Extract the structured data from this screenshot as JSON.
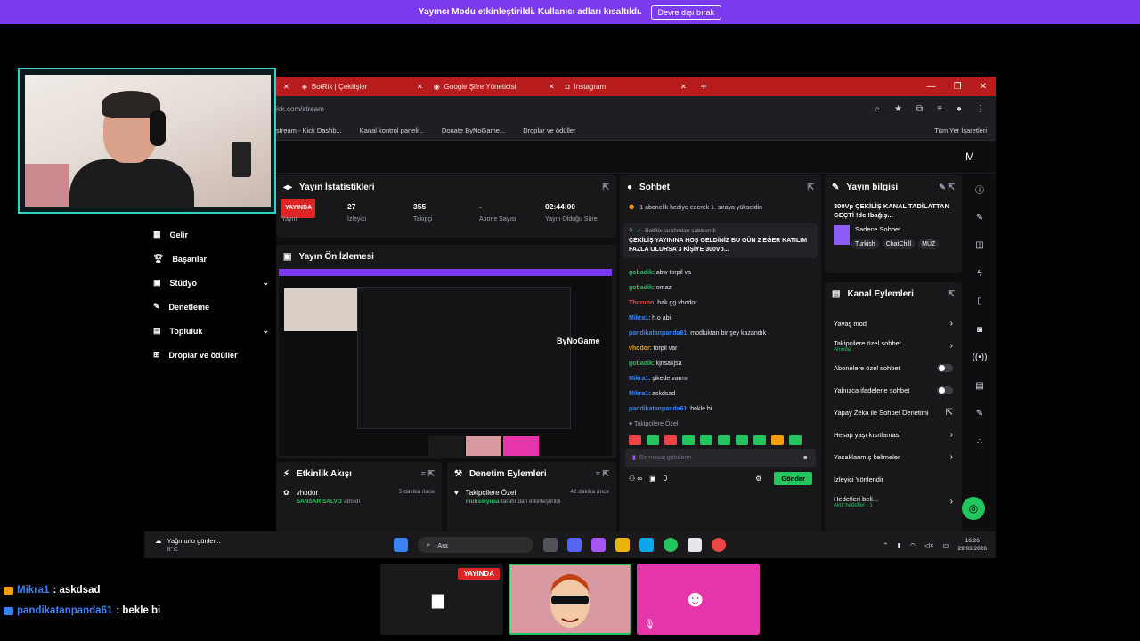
{
  "banner": {
    "text": "Yayıncı Modu etkinleştirildi. Kullanıcı adları kısaltıldı.",
    "button": "Devre dışı bırak"
  },
  "browser": {
    "tabs": [
      {
        "label": "BotRix | Çekilişler"
      },
      {
        "label": "Google Şifre Yöneticisi"
      },
      {
        "label": "Instagram"
      }
    ],
    "address": "ick.com/stream",
    "bookmarks": [
      "stream - Kick Dashb...",
      "Kanal kontrol paneli...",
      "Donate ByNoGame...",
      "Droplar ve ödüller"
    ],
    "all_bookmarks": "Tüm Yer İşaretleri"
  },
  "left_nav": {
    "items": [
      {
        "label": "Gelir",
        "icon": "chart-icon"
      },
      {
        "label": "Başarılar",
        "icon": "trophy-icon"
      },
      {
        "label": "Stüdyo",
        "icon": "studio-icon"
      },
      {
        "label": "Denetleme",
        "icon": "wrench-icon"
      },
      {
        "label": "Topluluk",
        "icon": "community-icon"
      },
      {
        "label": "Droplar ve ödüller",
        "icon": "gift-icon"
      }
    ]
  },
  "stats": {
    "title": "Yayın İstatistikleri",
    "live_badge": "YAYINDA",
    "cells": [
      {
        "value": "",
        "label": "Yayın"
      },
      {
        "value": "27",
        "label": "İzleyici"
      },
      {
        "value": "355",
        "label": "Takipçi"
      },
      {
        "value": "-",
        "label": "Abone Sayısı"
      },
      {
        "value": "02:44:00",
        "label": "Yayın Olduğu Süre"
      }
    ]
  },
  "preview": {
    "title": "Yayın Ön İzlemesi",
    "brand": "ByNoGame"
  },
  "activity": {
    "title": "Etkinlik Akışı",
    "items": [
      {
        "user": "vhodor",
        "sub": "SANSAR SALVO",
        "subtail": "atmıdı",
        "time": "5 dakika önce"
      }
    ]
  },
  "moderation": {
    "title": "Denetim Eylemleri",
    "items": [
      {
        "title": "Takipçilere Özel",
        "sub": "muhsinyusa",
        "subtail": "tarafından etkinleştirildi",
        "time": "42 dakika önce"
      }
    ]
  },
  "chat": {
    "title": "Sohbet",
    "gift_notice": "1 abonelik hediye ederek 1. sıraya yükseldin",
    "pinned_by": "BotRix tarafından sabitlendi",
    "pinned_text": "ÇEKİLİŞ YAYININA HOŞ GELDİNİZ BU GÜN 2 EĞER KATILIM FAZLA OLURSA 3 KİŞİYE 300Vp...",
    "messages": [
      {
        "user": "gobadik",
        "text": "abw torpil va",
        "color": "#22c55e"
      },
      {
        "user": "gobadik",
        "text": "omaz",
        "color": "#22c55e"
      },
      {
        "user": "Thorunn",
        "text": "hak gg vhodor",
        "color": "#ef4444"
      },
      {
        "user": "Mikra1",
        "text": "h.o abi",
        "color": "#3b82f6"
      },
      {
        "user": "pandikatanpanda61",
        "text": "modluktan bir şey kazandık",
        "color": "#3b82f6"
      },
      {
        "user": "vhodor",
        "text": "torpil var",
        "color": "#f59e0b"
      },
      {
        "user": "gobadik",
        "text": "kjnsakjsa",
        "color": "#22c55e"
      },
      {
        "user": "Mikra1",
        "text": "şikede varmı",
        "color": "#3b82f6"
      },
      {
        "user": "Mikra1",
        "text": "askdsad",
        "color": "#3b82f6"
      },
      {
        "user": "pandikatanpanda61",
        "text": "bekle bi",
        "color": "#3b82f6"
      }
    ],
    "followers_only": "Takipçilere Özel",
    "placeholder": "Bir mesaj gönderin",
    "counter": "0",
    "send": "Gönder"
  },
  "info": {
    "title": "Yayın bilgisi",
    "stream_title": "300Vp ÇEKİLİŞ KANAL TADİLATTAN GEÇTİ !dc !bağış...",
    "category": "Sadece Sohbet",
    "tags": [
      "Turkish",
      "ChatChill",
      "MÜZ"
    ]
  },
  "channel": {
    "title": "Kanal Eylemleri",
    "actions": [
      {
        "label": "Yavaş mod",
        "kind": "arrow"
      },
      {
        "label": "Takipçilere özel sohbet",
        "sub": "Anında",
        "kind": "arrow"
      },
      {
        "label": "Abonelere özel sohbet",
        "kind": "toggle"
      },
      {
        "label": "Yalnızca ifadelerle sohbet",
        "kind": "toggle"
      },
      {
        "label": "Yapay Zeka ile Sohbet Denetimi",
        "kind": "ext"
      },
      {
        "label": "Hesap yaşı kısıtlaması",
        "kind": "arrow"
      },
      {
        "label": "Yasaklanmış kelimeler",
        "kind": "arrow"
      },
      {
        "label": "İzleyici Yönlendir",
        "kind": "none"
      },
      {
        "label": "Hedefleri beli...",
        "sub": "Aktif hedefler - 1",
        "kind": "arrow"
      }
    ]
  },
  "taskbar": {
    "weather": "Yağmurlu günler...",
    "temp": "8°C",
    "search": "Ara",
    "time": "16:26",
    "date": "29.03.2026"
  },
  "overlay_chat": [
    {
      "user": "Mikra1",
      "text": ": askdsad",
      "color": "#3b82f6",
      "badge": "#f59e0b"
    },
    {
      "user": "pandikatanpanda61",
      "text": ": bekle bi",
      "color": "#3b82f6",
      "badge": "#3b82f6"
    }
  ],
  "scene_thumbs": {
    "live": "YAYINDA"
  }
}
